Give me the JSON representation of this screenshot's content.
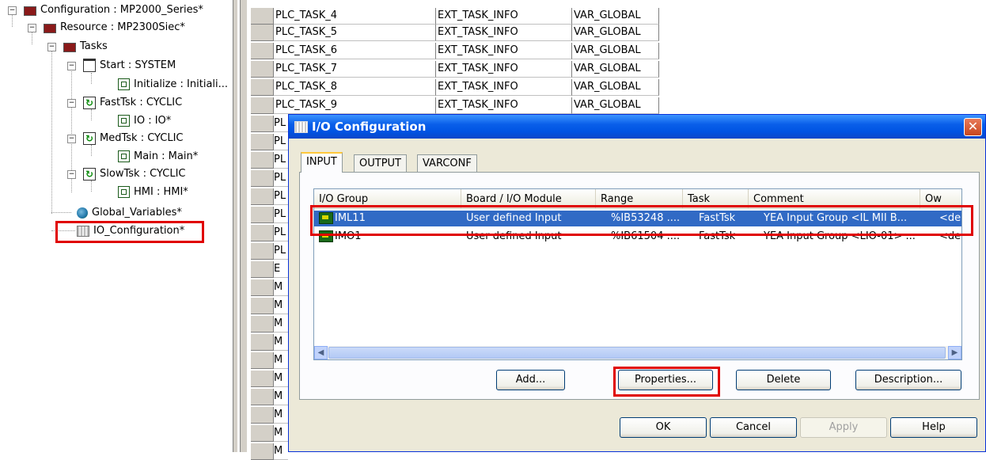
{
  "tree": {
    "items": [
      {
        "label": "Configuration : MP2000_Series*"
      },
      {
        "label": "Resource : MP2300Siec*"
      },
      {
        "label": "Tasks"
      },
      {
        "label": "Start : SYSTEM"
      },
      {
        "label": "Initialize : Initiali..."
      },
      {
        "label": "FastTsk : CYCLIC"
      },
      {
        "label": "IO : IO*"
      },
      {
        "label": "MedTsk : CYCLIC"
      },
      {
        "label": "Main : Main*"
      },
      {
        "label": "SlowTsk : CYCLIC"
      },
      {
        "label": "HMI : HMI*"
      },
      {
        "label": "Global_Variables*"
      },
      {
        "label": "IO_Configuration*"
      }
    ]
  },
  "grid": {
    "rows": [
      {
        "name": "PLC_TASK_4",
        "type": "EXT_TASK_INFO",
        "scope": "VAR_GLOBAL"
      },
      {
        "name": "PLC_TASK_5",
        "type": "EXT_TASK_INFO",
        "scope": "VAR_GLOBAL"
      },
      {
        "name": "PLC_TASK_6",
        "type": "EXT_TASK_INFO",
        "scope": "VAR_GLOBAL"
      },
      {
        "name": "PLC_TASK_7",
        "type": "EXT_TASK_INFO",
        "scope": "VAR_GLOBAL"
      },
      {
        "name": "PLC_TASK_8",
        "type": "EXT_TASK_INFO",
        "scope": "VAR_GLOBAL"
      },
      {
        "name": "PLC_TASK_9",
        "type": "EXT_TASK_INFO",
        "scope": "VAR_GLOBAL"
      }
    ],
    "stubs": [
      "PL",
      "PL",
      "PL",
      "PL",
      "PL",
      "PL",
      "PL",
      "PL",
      "E",
      "M",
      "M",
      "M",
      "M",
      "M",
      "M",
      "M",
      "M",
      "M",
      "M",
      "M"
    ]
  },
  "dialog": {
    "title": "I/O Configuration",
    "close_label": "✕",
    "tabs": [
      {
        "label": "INPUT"
      },
      {
        "label": "OUTPUT"
      },
      {
        "label": "VARCONF"
      }
    ],
    "columns": [
      "I/O Group",
      "Board / I/O Module",
      "Range",
      "Task",
      "Comment",
      "Ow"
    ],
    "rows": [
      {
        "group": "IML11",
        "module": "User defined Input",
        "range": "%IB53248 ....",
        "task": "FastTsk",
        "comment": "YEA Input Group <IL MII B...",
        "owner": "<de"
      },
      {
        "group": "IMO1",
        "module": "User defined Input",
        "range": "%IB61504 ....",
        "task": "FastTsk",
        "comment": "YEA Input Group <LIO-01> ...",
        "owner": "<de"
      }
    ],
    "buttons": {
      "add": "Add...",
      "properties": "Properties...",
      "delete": "Delete",
      "description": "Description...",
      "ok": "OK",
      "cancel": "Cancel",
      "apply": "Apply",
      "help": "Help"
    },
    "highlight_color": "#e00000",
    "selection_color": "#316ac5"
  }
}
